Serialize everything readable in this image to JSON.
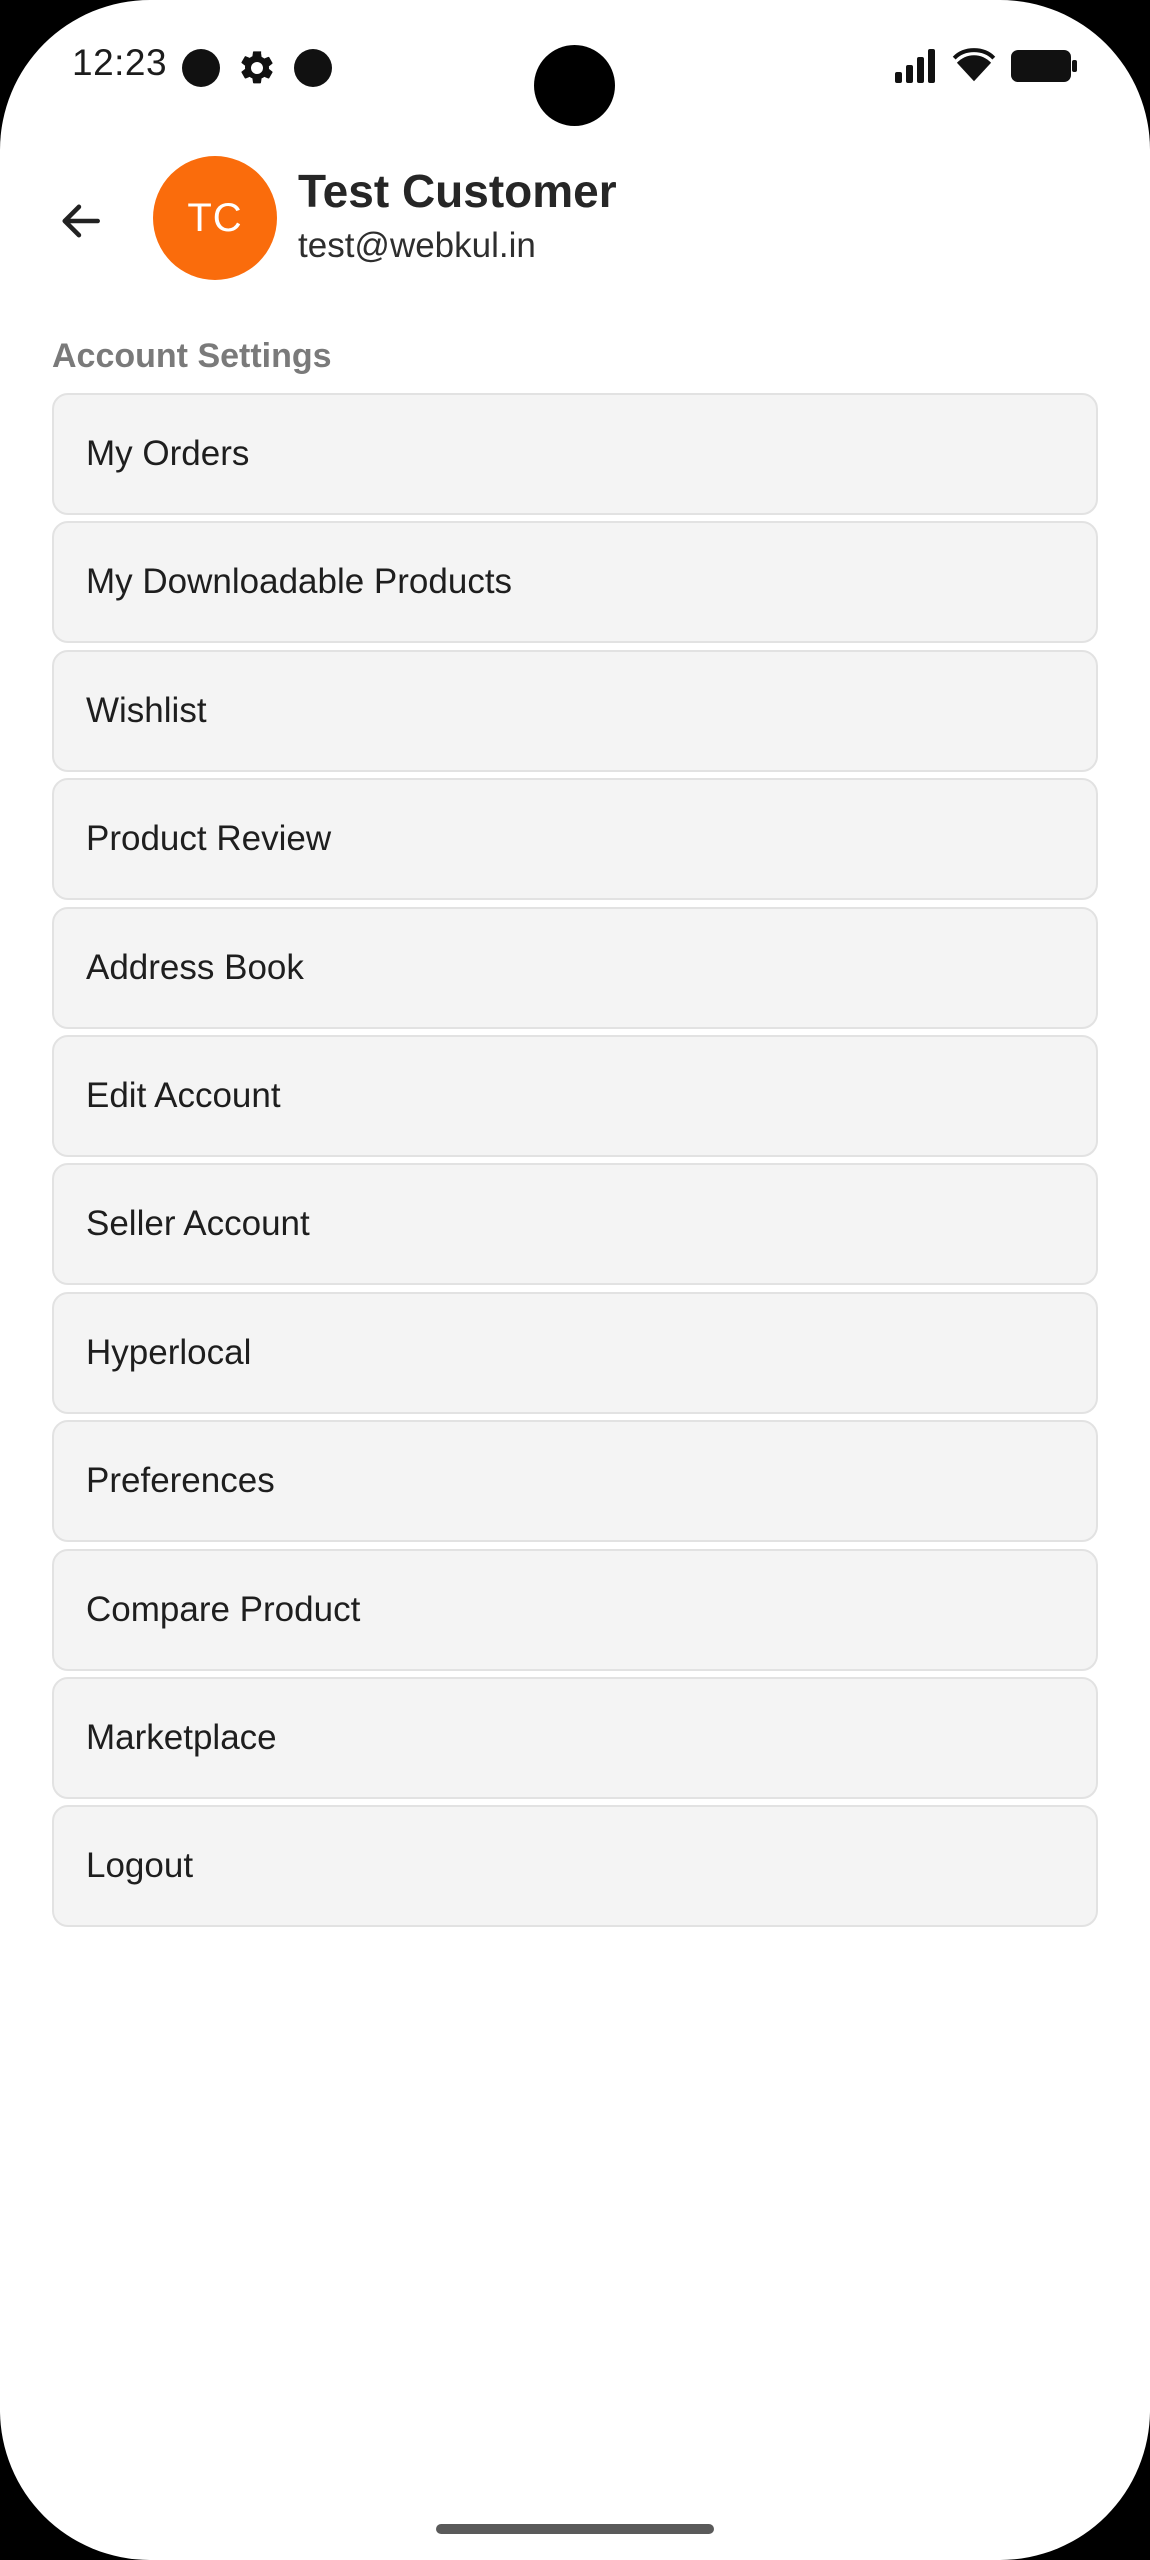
{
  "status_bar": {
    "time": "12:23",
    "icons": [
      "notification-dot-icon",
      "settings-gear-icon",
      "notification-dot-icon",
      "signal-icon",
      "wifi-icon",
      "battery-icon"
    ]
  },
  "header": {
    "back_icon": "arrow-left-icon",
    "avatar_initials": "TC",
    "avatar_color": "#fa6c0c",
    "name": "Test Customer",
    "email": "test@webkul.in"
  },
  "account_settings": {
    "title": "Account Settings",
    "items": [
      {
        "label": "My Orders"
      },
      {
        "label": "My Downloadable Products"
      },
      {
        "label": "Wishlist"
      },
      {
        "label": "Product Review"
      },
      {
        "label": "Address Book"
      },
      {
        "label": "Edit Account"
      },
      {
        "label": "Seller Account"
      },
      {
        "label": "Hyperlocal"
      },
      {
        "label": "Preferences"
      },
      {
        "label": "Compare Product"
      },
      {
        "label": "Marketplace"
      },
      {
        "label": "Logout"
      }
    ]
  }
}
